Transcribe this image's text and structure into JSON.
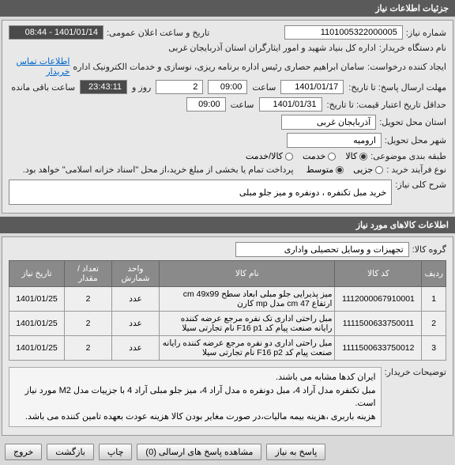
{
  "titleBar": "جزئیات اطلاعات نیاز",
  "form": {
    "needNoLabel": "شماره نیاز:",
    "needNo": "1101005322000005",
    "announceLabel": "تاریخ و ساعت اعلان عمومی:",
    "announceVal": "1401/01/14 - 08:44",
    "buyerLabel": "نام دستگاه خریدار:",
    "buyerVal": "اداره کل بنیاد شهید و امور ایثارگران استان آذربایجان غربی",
    "creatorLabel": "ایجاد کننده درخواست:",
    "creatorVal": "سامان ابراهیم حصاری رئیس اداره برنامه ریزی، نوسازی و خدمات الکترونیک اداره",
    "contactLink": "اطلاعات تماس خریدار",
    "deadlineLabel": "مهلت ارسال پاسخ: تا تاریخ:",
    "deadlineDate": "1401/01/17",
    "timeLabel": "ساعت",
    "deadlineTime": "09:00",
    "daysVal": "2",
    "daysLabel": "روز و",
    "remainTime": "23:43:11",
    "remainLabel": "ساعت باقی مانده",
    "validLabel": "حداقل تاریخ اعتبار قیمت: تا تاریخ:",
    "validDate": "1401/01/31",
    "validTime": "09:00",
    "provinceLabel": "استان محل تحویل:",
    "provinceVal": "آذربایجان غربی",
    "cityLabel": "شهر محل تحویل:",
    "cityVal": "ارومیه",
    "categoryLabel": "طبقه بندی موضوعی:",
    "catOptions": [
      "کالا",
      "خدمت",
      "کالا/خدمت"
    ],
    "processLabel": "نوع فرآیند خرید :",
    "procOptions": [
      "جزیی",
      "متوسط"
    ],
    "procNote": "پرداخت تمام یا بخشی از مبلغ خرید،از محل \"اسناد خزانه اسلامی\" خواهد بود.",
    "descFieldLabel": "شرح کلی نیاز:",
    "descFieldVal": "خرید مبل تکنفره ، دونفره و  میز جلو مبلی"
  },
  "itemsSection": {
    "title": "اطلاعات کالاهای مورد نیاز",
    "groupLabel": "گروه کالا:",
    "groupVal": "تجهیزات و وسایل تحصیلی واداری",
    "headers": [
      "ردیف",
      "کد کالا",
      "نام کالا",
      "واحد شمارش",
      "تعداد / مقدار",
      "تاریخ نیاز"
    ],
    "rows": [
      {
        "n": "1",
        "code": "1112000067910001",
        "name": "میز پذیرایی جلو مبلی ابعاد سطح cm 49x99 ارتفاع cm 47 مدل mp کارن",
        "unit": "عدد",
        "qty": "2",
        "date": "1401/01/25"
      },
      {
        "n": "2",
        "code": "1111500633750011",
        "name": "مبل راحتی اداری تک نفره مرجع عرضه کننده رایانه صنعت پیام کد F16 p1 نام تجارتی سیلا",
        "unit": "عدد",
        "qty": "2",
        "date": "1401/01/25"
      },
      {
        "n": "3",
        "code": "1111500633750012",
        "name": "مبل راحتی اداری دو نفره مرجع عرضه کننده رایانه صنعت پیام کد F16 p2 نام تجارتی سیلا",
        "unit": "عدد",
        "qty": "2",
        "date": "1401/01/25"
      }
    ]
  },
  "buyerNotes": {
    "label": "توضیحات خریدار:",
    "text": "ایران کدها مشابه می باشند.\nمبل تکنفره مدل آراد 4، مبل دونفره ه مدل آراد 4، میز جلو مبلی آراد 4 با جزییات مدل M2 مورد نیاز است.\nهزینه باربری ،هزینه بیمه مالیات،در صورت مغایر بودن کالا هزینه عودت بعهده تامین کننده می باشد."
  },
  "buttons": {
    "reply": "پاسخ به نیاز",
    "viewReplies": "مشاهده پاسخ های ارسالی (0)",
    "print": "چاپ",
    "back": "بازگشت",
    "exit": "خروج"
  }
}
